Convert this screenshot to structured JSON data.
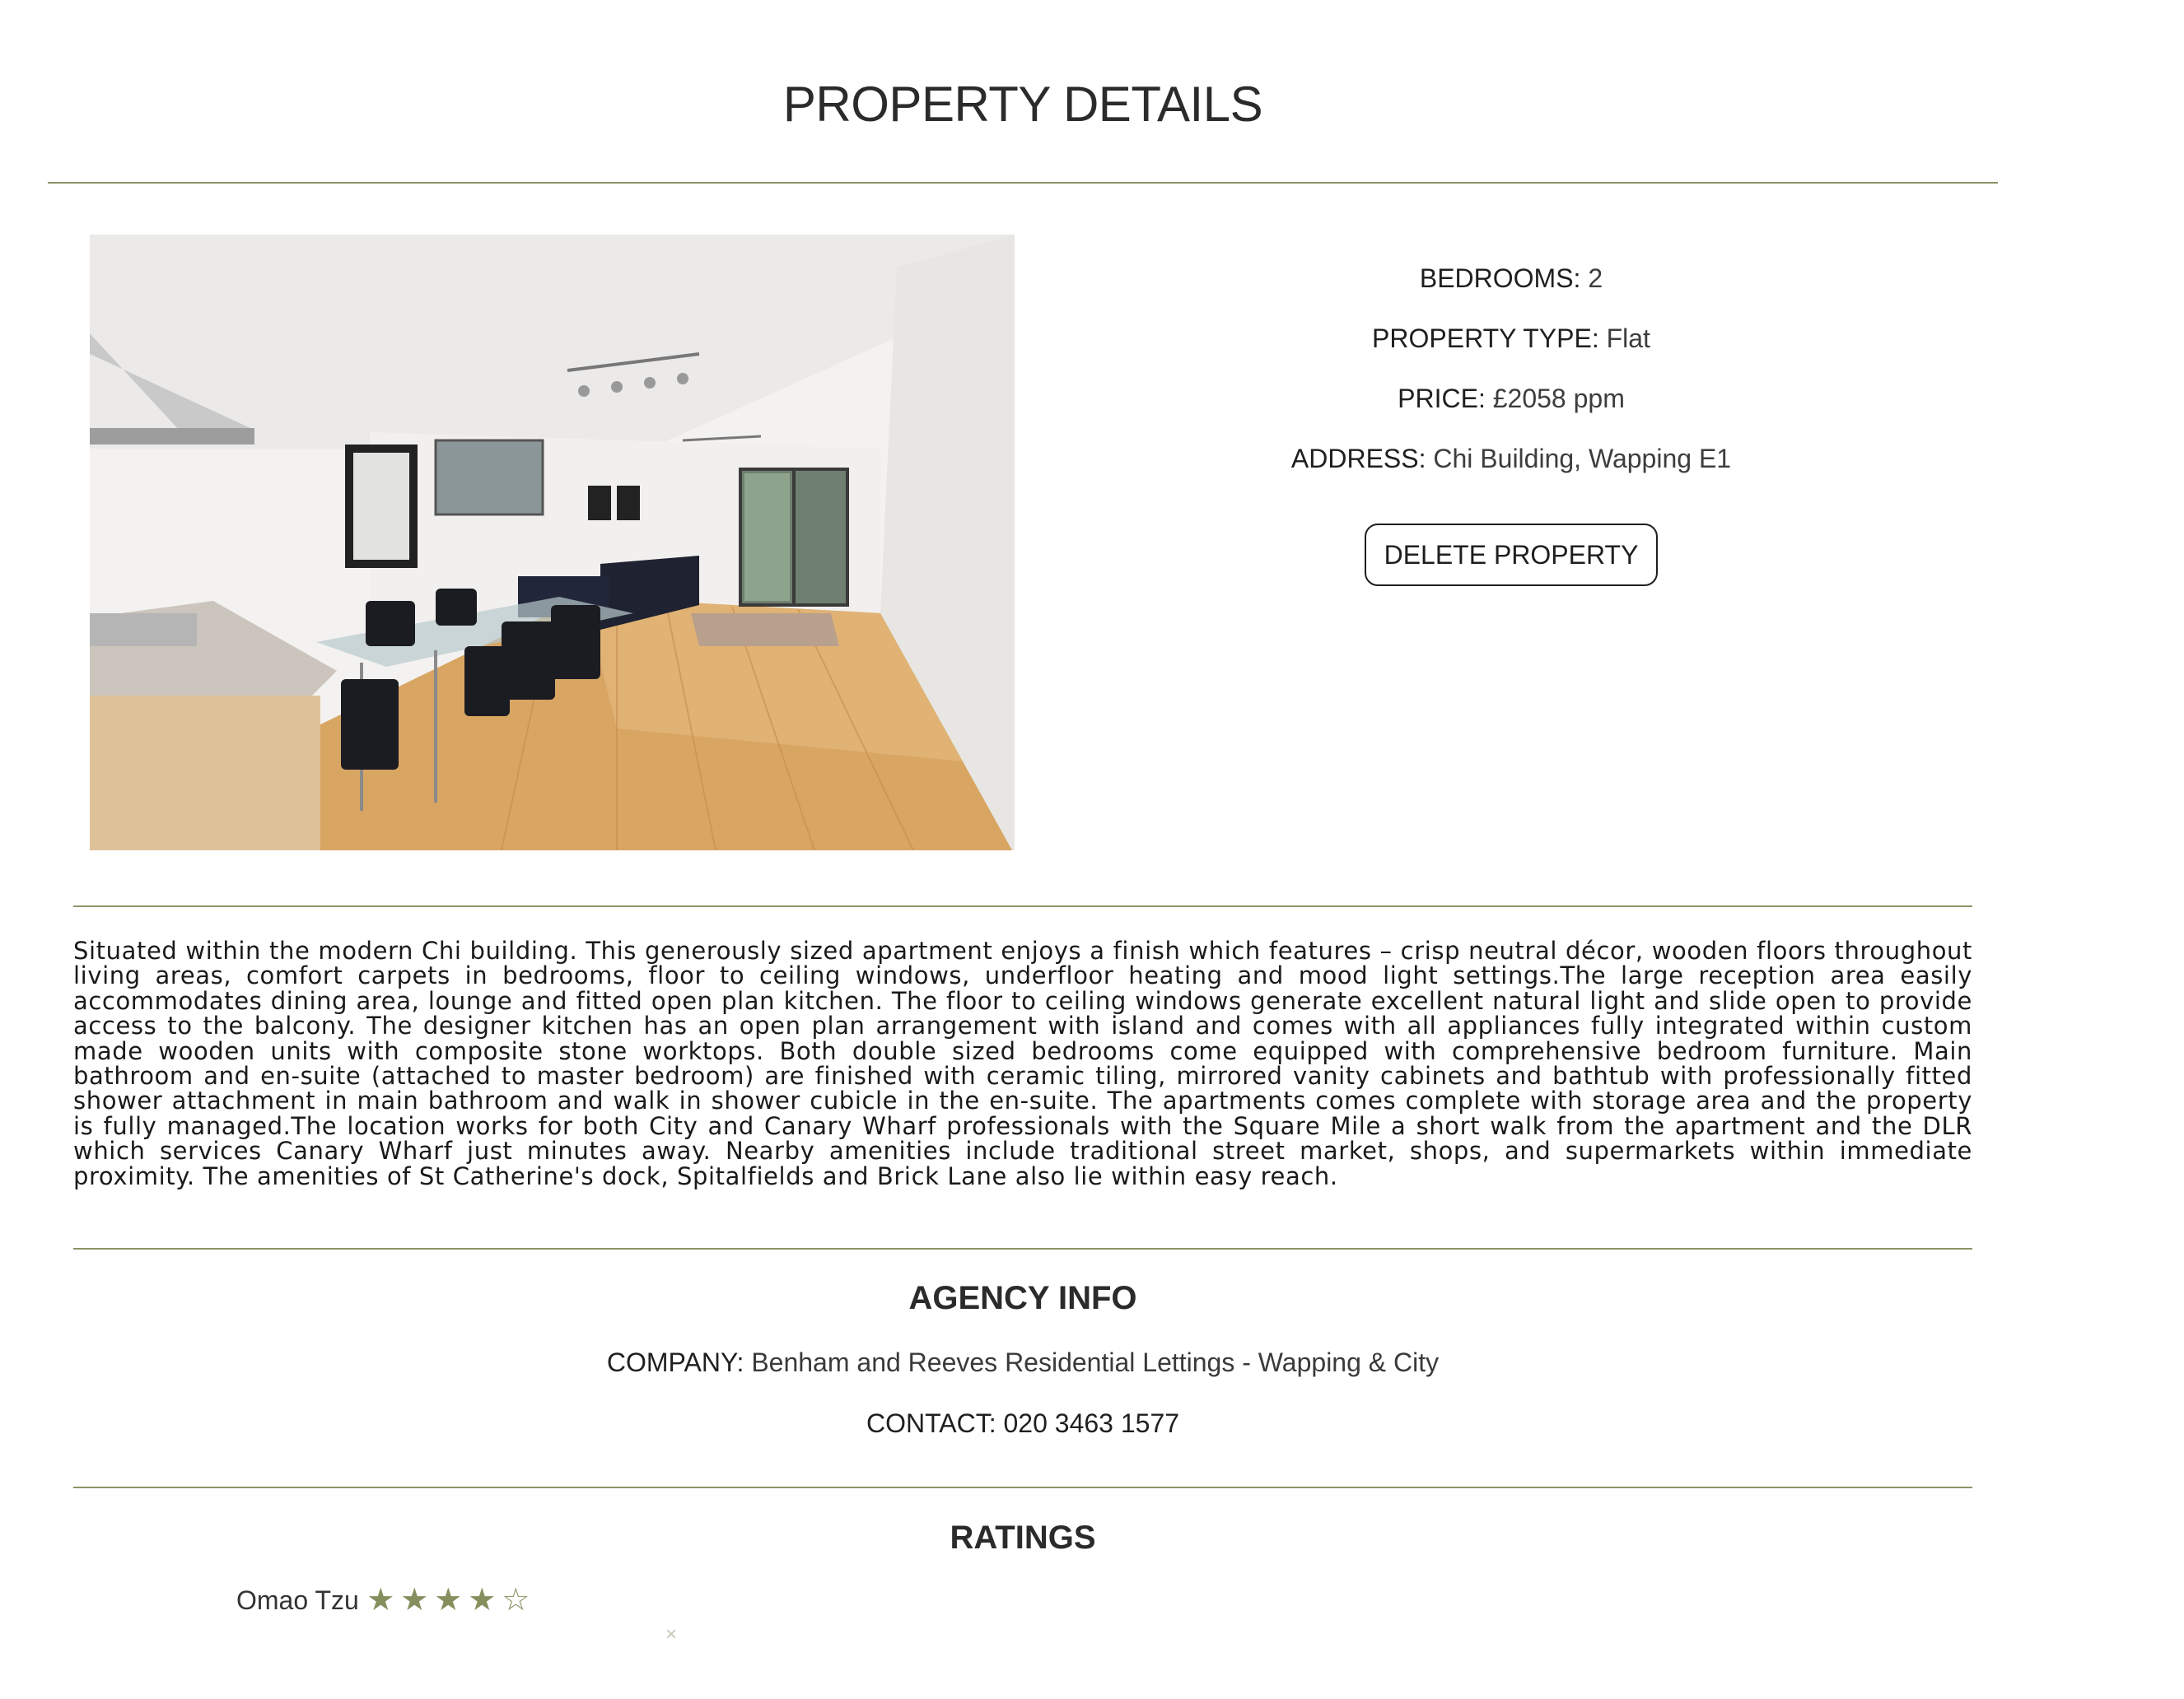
{
  "page": {
    "title": "PROPERTY DETAILS"
  },
  "property": {
    "bedrooms_label": "BEDROOMS:",
    "bedrooms_value": "2",
    "type_label": "PROPERTY TYPE:",
    "type_value": "Flat",
    "price_label": "PRICE:",
    "price_value": "£2058 ppm",
    "address_label": "ADDRESS:",
    "address_value": "Chi Building, Wapping E1",
    "delete_label": "DELETE PROPERTY",
    "photo_icon": "apartment-photo",
    "description": "Situated within the modern Chi building. This generously sized apartment enjoys a finish which features – crisp neutral décor, wooden floors throughout living areas, comfort carpets in bedrooms, floor to ceiling windows, underfloor heating and mood light settings.The large reception area easily accommodates dining area, lounge and fitted open plan kitchen. The floor to ceiling windows generate excellent natural light and slide open to provide access to the balcony. The designer kitchen has an open plan arrangement with island and comes with all appliances fully integrated within custom made wooden units with composite stone worktops. Both double sized bedrooms come equipped with comprehensive bedroom furniture. Main bathroom and en-suite (attached to master bedroom) are finished with ceramic tiling, mirrored vanity cabinets and bathtub with professionally fitted shower attachment in main bathroom and walk in shower cubicle in the en-suite. The apartments comes complete with storage area and the property is fully managed.The location works for both City and Canary Wharf professionals with the Square Mile a short walk from the apartment and the DLR which services Canary Wharf just minutes away. Nearby amenities include traditional street market, shops, and supermarkets within immediate proximity. The amenities of St Catherine's dock, Spitalfields and Brick Lane also lie within easy reach."
  },
  "agency": {
    "title": "AGENCY INFO",
    "company_label": "COMPANY:",
    "company_value": "Benham and Reeves Residential Lettings - Wapping & City",
    "contact_label": "CONTACT:",
    "contact_value": "020 3463 1577"
  },
  "ratings": {
    "title": "RATINGS",
    "items": [
      {
        "name": "Omao Tzu",
        "stars": 4,
        "max": 5,
        "remove_symbol": "×"
      }
    ]
  },
  "colors": {
    "accent": "#858f5e",
    "rule": "#8a9466",
    "text": "#2b2b2b"
  }
}
